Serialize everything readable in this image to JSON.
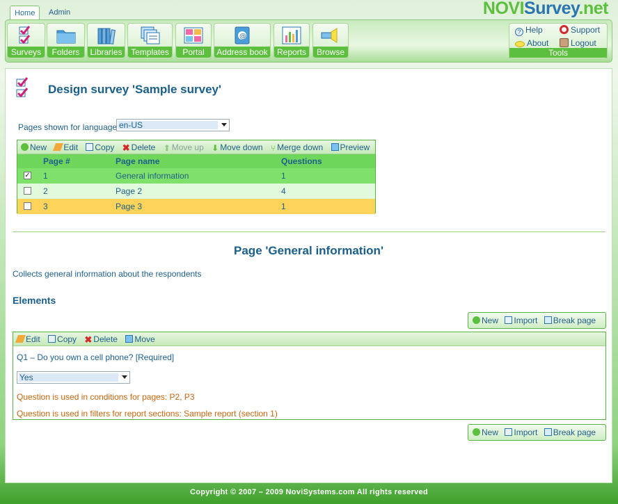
{
  "top_tabs": [
    {
      "label": "Home",
      "active": true
    },
    {
      "label": "Admin",
      "active": false
    }
  ],
  "logo": {
    "part1": "NOVI",
    "part2": "Survey",
    "part3": ".net"
  },
  "toolbar": {
    "items": [
      {
        "label": "Surveys",
        "icon": "surveys-icon"
      },
      {
        "label": "Folders",
        "icon": "folders-icon"
      },
      {
        "label": "Libraries",
        "icon": "libraries-icon"
      },
      {
        "label": "Templates",
        "icon": "templates-icon"
      },
      {
        "label": "Portal",
        "icon": "portal-icon"
      },
      {
        "label": "Address book",
        "icon": "address-book-icon"
      },
      {
        "label": "Reports",
        "icon": "reports-icon"
      },
      {
        "label": "Browse",
        "icon": "browse-icon"
      }
    ],
    "tools": {
      "label": "Tools",
      "help": "Help",
      "support": "Support",
      "about": "About",
      "logout": "Logout"
    }
  },
  "page": {
    "title": "Design survey 'Sample survey'",
    "language_label": "Pages shown for language",
    "language_value": "en-US"
  },
  "pages_table": {
    "actions": [
      {
        "label": "New",
        "enabled": true
      },
      {
        "label": "Edit",
        "enabled": true
      },
      {
        "label": "Copy",
        "enabled": true
      },
      {
        "label": "Delete",
        "enabled": true
      },
      {
        "label": "Move up",
        "enabled": false
      },
      {
        "label": "Move down",
        "enabled": true
      },
      {
        "label": "Merge down",
        "enabled": true
      },
      {
        "label": "Preview",
        "enabled": true
      }
    ],
    "columns": [
      "Page #",
      "Page name",
      "Questions"
    ],
    "rows": [
      {
        "num": "1",
        "name": "General information",
        "questions": "1",
        "checked": true,
        "color": "#7fe06a"
      },
      {
        "num": "2",
        "name": "Page 2",
        "questions": "4",
        "checked": false,
        "color": "#e2fadc"
      },
      {
        "num": "3",
        "name": "Page 3",
        "questions": "1",
        "checked": false,
        "color": "#fdd35a"
      }
    ]
  },
  "page_section": {
    "title": "Page 'General information'",
    "description": "Collects general information about the respondents",
    "elements_heading": "Elements"
  },
  "element_buttons": {
    "new": "New",
    "import": "Import",
    "break": "Break page"
  },
  "element_box": {
    "actions": {
      "edit": "Edit",
      "copy": "Copy",
      "delete": "Delete",
      "move": "Move"
    },
    "question": "Q1 – Do you own a cell phone?  [Required]",
    "answer": "Yes",
    "note1": "Question is used in conditions for pages: P2, P3",
    "note2": "Question is used in filters for report sections: Sample report (section 1)"
  },
  "footer": "Copyright © 2007 – 2009 NoviSystems.com All rights reserved",
  "colors": {
    "accent_green": "#5cbf3e",
    "title_blue": "#1a5f8c",
    "orange_note": "#c8650d"
  }
}
